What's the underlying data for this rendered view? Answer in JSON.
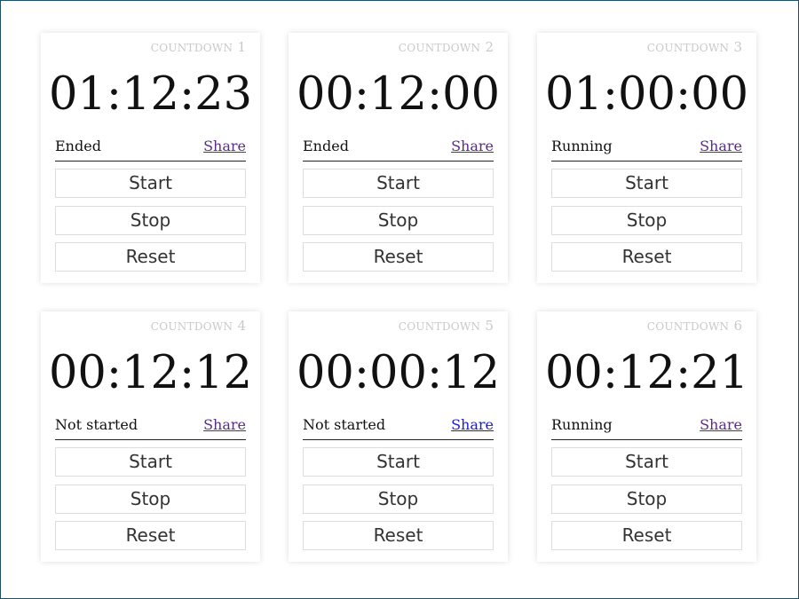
{
  "timers": [
    {
      "label": "COUNTDOWN",
      "number": "1",
      "time": "01:12:23",
      "status": "Ended",
      "share": "Share",
      "start": "Start",
      "stop": "Stop",
      "reset": "Reset"
    },
    {
      "label": "COUNTDOWN",
      "number": "2",
      "time": "00:12:00",
      "status": "Ended",
      "share": "Share",
      "start": "Start",
      "stop": "Stop",
      "reset": "Reset"
    },
    {
      "label": "COUNTDOWN",
      "number": "3",
      "time": "01:00:00",
      "status": "Running",
      "share": "Share",
      "start": "Start",
      "stop": "Stop",
      "reset": "Reset"
    },
    {
      "label": "COUNTDOWN",
      "number": "4",
      "time": "00:12:12",
      "status": "Not started",
      "share": "Share",
      "start": "Start",
      "stop": "Stop",
      "reset": "Reset"
    },
    {
      "label": "COUNTDOWN",
      "number": "5",
      "time": "00:00:12",
      "status": "Not started",
      "share": "Share",
      "start": "Start",
      "stop": "Stop",
      "reset": "Reset"
    },
    {
      "label": "COUNTDOWN",
      "number": "6",
      "time": "00:12:21",
      "status": "Running",
      "share": "Share",
      "start": "Start",
      "stop": "Stop",
      "reset": "Reset"
    }
  ],
  "colors": {
    "visited_link": "#5a2b86",
    "active_link": "#1a1adb",
    "frame_border": "#1f4f66"
  }
}
